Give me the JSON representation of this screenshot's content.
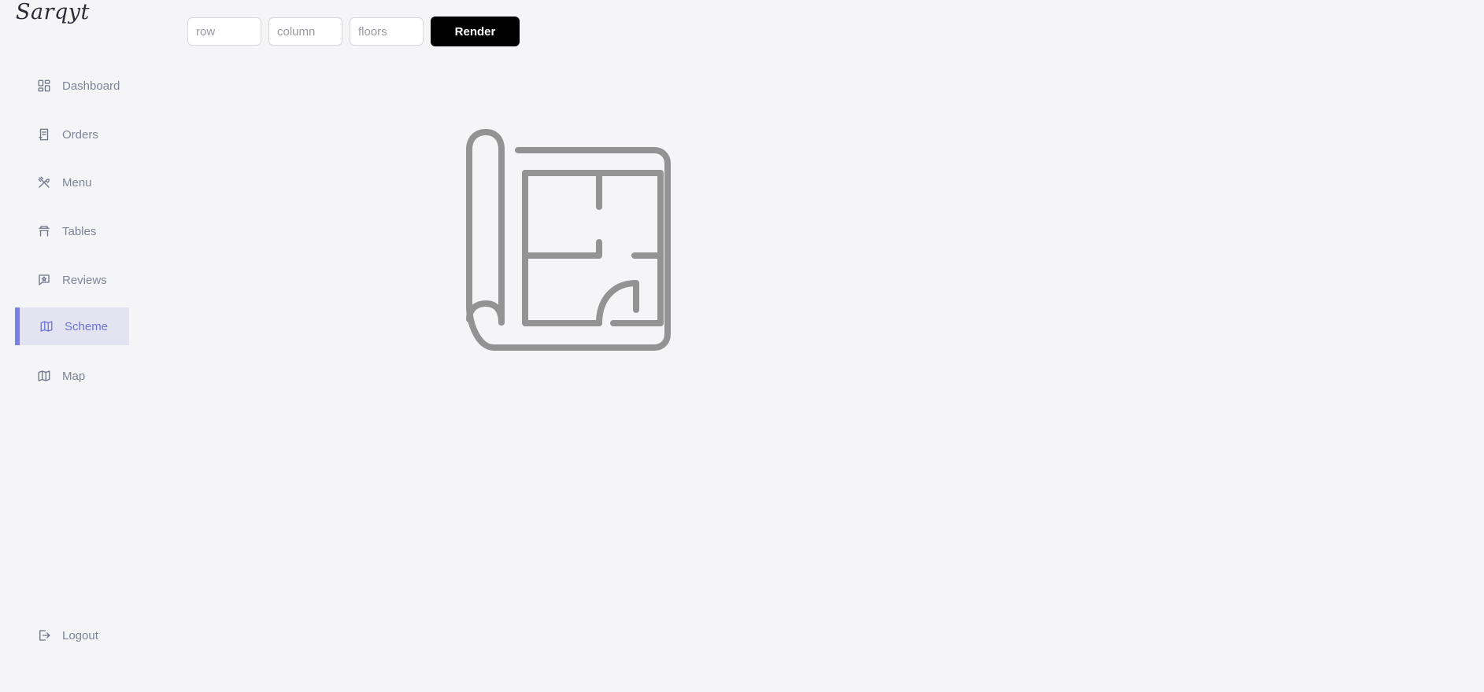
{
  "app": {
    "logo_text": "Sarqyt"
  },
  "sidebar": {
    "items": [
      {
        "label": "Dashboard",
        "icon": "dashboard-icon",
        "active": false
      },
      {
        "label": "Orders",
        "icon": "receipt-icon",
        "active": false
      },
      {
        "label": "Menu",
        "icon": "utensils-icon",
        "active": false
      },
      {
        "label": "Tables",
        "icon": "table-icon",
        "active": false
      },
      {
        "label": "Reviews",
        "icon": "star-message-icon",
        "active": false
      },
      {
        "label": "Scheme",
        "icon": "map-icon",
        "active": true
      },
      {
        "label": "Map",
        "icon": "map-icon",
        "active": false
      }
    ],
    "logout_label": "Logout",
    "active_color": "#6d74d6",
    "active_bg": "#e3e3f2"
  },
  "toolbar": {
    "row_placeholder": "row",
    "row_value": "",
    "column_placeholder": "column",
    "column_value": "",
    "floors_placeholder": "floors",
    "floors_value": "",
    "render_label": "Render"
  },
  "main": {
    "placeholder_icon": "blueprint-icon"
  }
}
